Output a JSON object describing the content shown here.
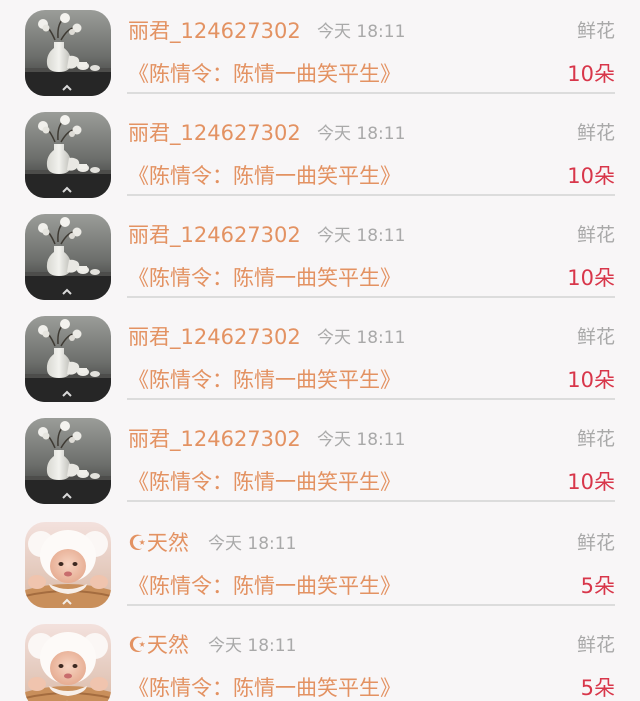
{
  "colors": {
    "background": "#f8f6f7",
    "username": "#e39262",
    "book_title": "#e39262",
    "count": "#d8364a",
    "muted": "#a9a9a9",
    "divider": "#dcdcdc"
  },
  "records": [
    {
      "avatar": "vase-avatar-icon",
      "username": "丽君_124627302",
      "time": "今天 18:11",
      "gift": "鲜花",
      "book_title": "《陈情令：陈情一曲笑平生》",
      "count": "10朵"
    },
    {
      "avatar": "vase-avatar-icon",
      "username": "丽君_124627302",
      "time": "今天 18:11",
      "gift": "鲜花",
      "book_title": "《陈情令：陈情一曲笑平生》",
      "count": "10朵"
    },
    {
      "avatar": "vase-avatar-icon",
      "username": "丽君_124627302",
      "time": "今天 18:11",
      "gift": "鲜花",
      "book_title": "《陈情令：陈情一曲笑平生》",
      "count": "10朵"
    },
    {
      "avatar": "vase-avatar-icon",
      "username": "丽君_124627302",
      "time": "今天 18:11",
      "gift": "鲜花",
      "book_title": "《陈情令：陈情一曲笑平生》",
      "count": "10朵"
    },
    {
      "avatar": "vase-avatar-icon",
      "username": "丽君_124627302",
      "time": "今天 18:11",
      "gift": "鲜花",
      "book_title": "《陈情令：陈情一曲笑平生》",
      "count": "10朵"
    },
    {
      "avatar": "baby-avatar-icon",
      "username": "☪天然",
      "time": "今天 18:11",
      "gift": "鲜花",
      "book_title": "《陈情令：陈情一曲笑平生》",
      "count": "5朵"
    },
    {
      "avatar": "baby-avatar-icon",
      "username": "☪天然",
      "time": "今天 18:11",
      "gift": "鲜花",
      "book_title": "《陈情令：陈情一曲笑平生》",
      "count": "5朵"
    }
  ]
}
